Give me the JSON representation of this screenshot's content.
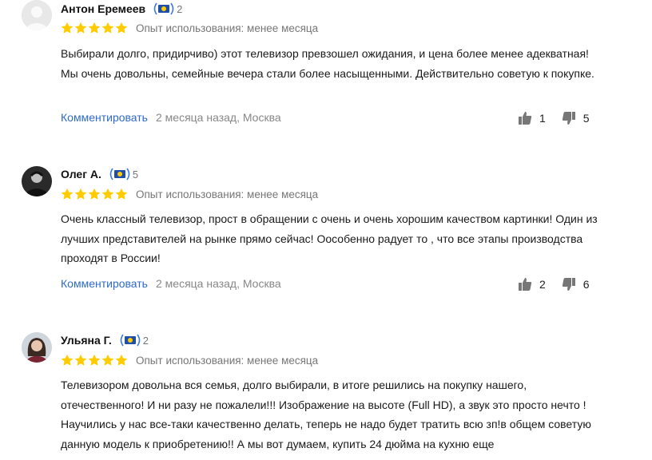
{
  "reviews": [
    {
      "author": "Антон Еремеев",
      "badge_count": "2",
      "experience": "Опыт использования: менее месяца",
      "text": "Выбирали долго, придирчиво) этот телевизор превзошел ожидания, и цена более менее адекватная! Мы очень довольны, семейные вечера стали более насыщенными. Действительно советую к покупке.",
      "comment_label": "Комментировать",
      "meta": "2 месяца назад, Москва",
      "likes": "1",
      "dislikes": "5",
      "rating": 5
    },
    {
      "author": "Олег А.",
      "badge_count": "5",
      "experience": "Опыт использования: менее месяца",
      "text": "Очень классный телевизор, прост в обращении с очень и очень хорошим качеством картинки! Один из лучших представителей на рынке прямо сейчас! Оособенно радует то , что все этапы производства проходят в России!",
      "comment_label": "Комментировать",
      "meta": "2 месяца назад, Москва",
      "likes": "2",
      "dislikes": "6",
      "rating": 5
    },
    {
      "author": "Ульяна Г.",
      "badge_count": "2",
      "experience": "Опыт использования: менее месяца",
      "text": "Телевизором довольна вся семья, долго выбирали, в итоге решились на покупку нашего, отечественного! И ни разу не пожалели!!! Изображение на высоте (Full HD), а звук это просто нечто ! Научились у нас все-таки качественно делать, теперь не надо будет тратить всю зп!в общем советую данную модель к приобретению!! А мы вот думаем, купить 24 дюйма на кухню еще",
      "rating": 5
    }
  ],
  "colors": {
    "star": "#ffcc00",
    "link": "#2f6bc9",
    "muted": "#777777",
    "badge_blue": "#1f4fa8"
  }
}
